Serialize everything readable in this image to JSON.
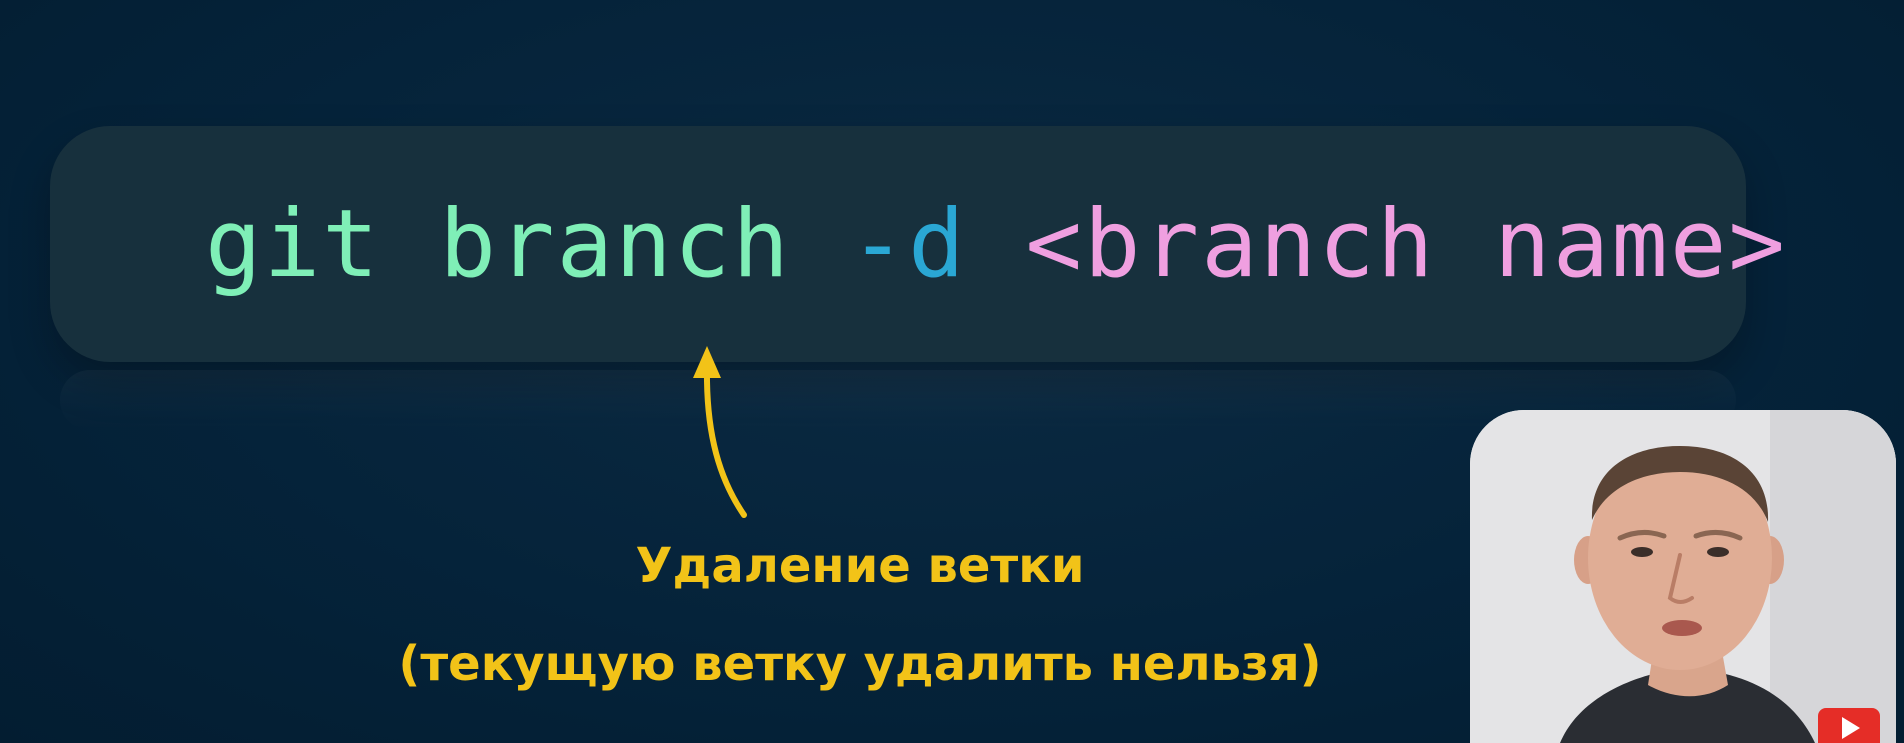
{
  "slide": {
    "command": {
      "cmd": "git branch ",
      "flag": "-d",
      "space": " ",
      "arg": "<branch name>"
    },
    "caption_line1": "Удаление ветки",
    "caption_line2": "(текущую ветку удалить нельзя)"
  },
  "colors": {
    "background": "#05233a",
    "command": "#7fefb7",
    "flag": "#2aa7d4",
    "argument": "#ef9fe0",
    "caption": "#f2c318",
    "arrow": "#f2c318"
  },
  "icons": {
    "arrow": "curved-arrow-up-icon",
    "badge": "youtube-play-icon"
  }
}
